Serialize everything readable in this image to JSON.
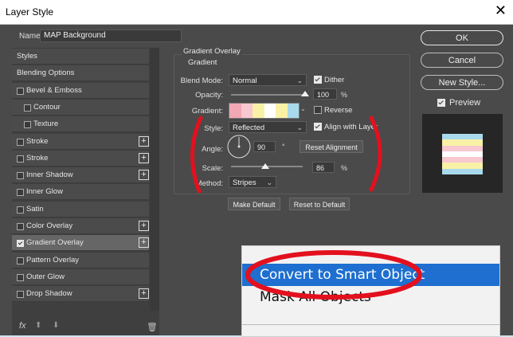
{
  "window": {
    "title": "Layer Style",
    "close_glyph": "✕"
  },
  "name_field": {
    "label": "Name:",
    "value": "MAP Background"
  },
  "styles_panel": {
    "items": [
      {
        "label": "Styles",
        "checkbox": false,
        "checked": false,
        "plus": false,
        "selected": false,
        "indent": false
      },
      {
        "label": "Blending Options",
        "checkbox": false,
        "checked": false,
        "plus": false,
        "selected": false,
        "indent": false
      },
      {
        "label": "Bevel & Emboss",
        "checkbox": true,
        "checked": false,
        "plus": false,
        "selected": false,
        "indent": false
      },
      {
        "label": "Contour",
        "checkbox": true,
        "checked": false,
        "plus": false,
        "selected": false,
        "indent": true
      },
      {
        "label": "Texture",
        "checkbox": true,
        "checked": false,
        "plus": false,
        "selected": false,
        "indent": true
      },
      {
        "label": "Stroke",
        "checkbox": true,
        "checked": false,
        "plus": true,
        "selected": false,
        "indent": false
      },
      {
        "label": "Stroke",
        "checkbox": true,
        "checked": false,
        "plus": true,
        "selected": false,
        "indent": false
      },
      {
        "label": "Inner Shadow",
        "checkbox": true,
        "checked": false,
        "plus": true,
        "selected": false,
        "indent": false
      },
      {
        "label": "Inner Glow",
        "checkbox": true,
        "checked": false,
        "plus": false,
        "selected": false,
        "indent": false
      },
      {
        "label": "Satin",
        "checkbox": true,
        "checked": false,
        "plus": false,
        "selected": false,
        "indent": false
      },
      {
        "label": "Color Overlay",
        "checkbox": true,
        "checked": false,
        "plus": true,
        "selected": false,
        "indent": false
      },
      {
        "label": "Gradient Overlay",
        "checkbox": true,
        "checked": true,
        "plus": true,
        "selected": true,
        "indent": false
      },
      {
        "label": "Pattern Overlay",
        "checkbox": true,
        "checked": false,
        "plus": false,
        "selected": false,
        "indent": false
      },
      {
        "label": "Outer Glow",
        "checkbox": true,
        "checked": false,
        "plus": false,
        "selected": false,
        "indent": false
      },
      {
        "label": "Drop Shadow",
        "checkbox": true,
        "checked": false,
        "plus": true,
        "selected": false,
        "indent": false
      }
    ],
    "footer": {
      "fx": "fx",
      "up_arrow": "⬆",
      "down_arrow": "⬇",
      "trash": "🗑"
    }
  },
  "gradient_overlay": {
    "group_title": "Gradient Overlay",
    "sub_title": "Gradient",
    "blend_mode": {
      "label": "Blend Mode:",
      "value": "Normal"
    },
    "dither": {
      "label": "Dither",
      "checked": true
    },
    "opacity": {
      "label": "Opacity:",
      "value": "100",
      "unit": "%",
      "level": 1.0
    },
    "gradient": {
      "label": "Gradient:",
      "stops": [
        "#f2a7b5",
        "#f7c8d0",
        "#f9f2a6",
        "#ffffff",
        "#f9f2a6",
        "#a9d9ec"
      ]
    },
    "reverse": {
      "label": "Reverse",
      "checked": false
    },
    "style": {
      "label": "Style:",
      "value": "Reflected"
    },
    "align": {
      "label": "Align with Layer",
      "checked": true
    },
    "angle": {
      "label": "Angle:",
      "value": "90",
      "unit": "°"
    },
    "reset_alignment": "Reset Alignment",
    "scale": {
      "label": "Scale:",
      "value": "86",
      "unit": "%",
      "level": 0.43
    },
    "method": {
      "label": "Method:",
      "value": "Stripes"
    },
    "make_default": "Make Default",
    "reset_default": "Reset to Default"
  },
  "right_buttons": {
    "ok": "OK",
    "cancel": "Cancel",
    "new_style": "New Style...",
    "preview": {
      "label": "Preview",
      "checked": true
    }
  },
  "preview_swatch": {
    "stripes": [
      "#a9d9ec",
      "#f9f2a6",
      "#f7c8d0",
      "#ffffff",
      "#f7c8d0",
      "#f9f2a6",
      "#a9d9ec"
    ]
  },
  "context_menu": {
    "items": [
      "Convert to Smart Object",
      "Mask All Objects"
    ],
    "highlight_color": "#1e6fd0",
    "annotation_color": "#e3101e"
  }
}
